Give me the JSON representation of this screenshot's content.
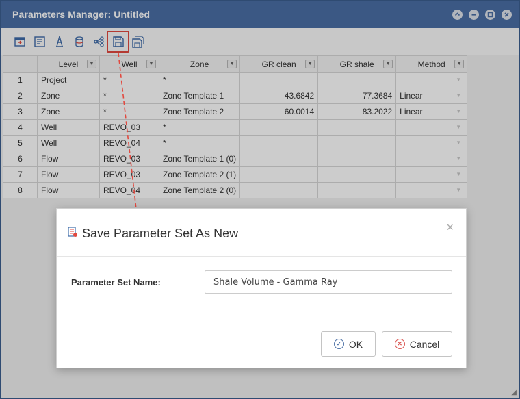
{
  "window": {
    "title": "Parameters Manager: Untitled"
  },
  "window_controls": [
    "minimize-icon",
    "restore-icon",
    "maximize-icon",
    "close-icon"
  ],
  "toolbar": {
    "buttons": [
      "import-icon",
      "list-icon",
      "well-derrick-icon",
      "database-icon",
      "tree-icon",
      "save-icon",
      "save-as-icon"
    ],
    "highlighted": "save-icon"
  },
  "grid": {
    "columns": [
      "",
      "Level",
      "Well",
      "Zone",
      "GR clean",
      "GR shale",
      "Method"
    ],
    "rows": [
      {
        "num": "1",
        "level": "Project",
        "well": "*",
        "zone": "*",
        "gr_clean": "",
        "gr_shale": "",
        "method": ""
      },
      {
        "num": "2",
        "level": "Zone",
        "well": "*",
        "zone": "Zone Template 1",
        "gr_clean": "43.6842",
        "gr_shale": "77.3684",
        "method": "Linear"
      },
      {
        "num": "3",
        "level": "Zone",
        "well": "*",
        "zone": "Zone Template 2",
        "gr_clean": "60.0014",
        "gr_shale": "83.2022",
        "method": "Linear"
      },
      {
        "num": "4",
        "level": "Well",
        "well": "REVO_03",
        "zone": "*",
        "gr_clean": "",
        "gr_shale": "",
        "method": ""
      },
      {
        "num": "5",
        "level": "Well",
        "well": "REVO_04",
        "zone": "*",
        "gr_clean": "",
        "gr_shale": "",
        "method": ""
      },
      {
        "num": "6",
        "level": "Flow",
        "well": "REVO_03",
        "zone": "Zone Template 1 (0)",
        "gr_clean": "",
        "gr_shale": "",
        "method": ""
      },
      {
        "num": "7",
        "level": "Flow",
        "well": "REVO_03",
        "zone": "Zone Template 2 (1)",
        "gr_clean": "",
        "gr_shale": "",
        "method": ""
      },
      {
        "num": "8",
        "level": "Flow",
        "well": "REVO_04",
        "zone": "Zone Template 2 (0)",
        "gr_clean": "",
        "gr_shale": "",
        "method": ""
      }
    ]
  },
  "dialog": {
    "title": "Save Parameter Set As New",
    "field_label": "Parameter Set Name:",
    "field_value": "Shale Volume - Gamma Ray",
    "ok_label": "OK",
    "cancel_label": "Cancel",
    "close_glyph": "×"
  },
  "colors": {
    "titlebar": "#4a6fa5",
    "highlight": "#e2493f"
  }
}
